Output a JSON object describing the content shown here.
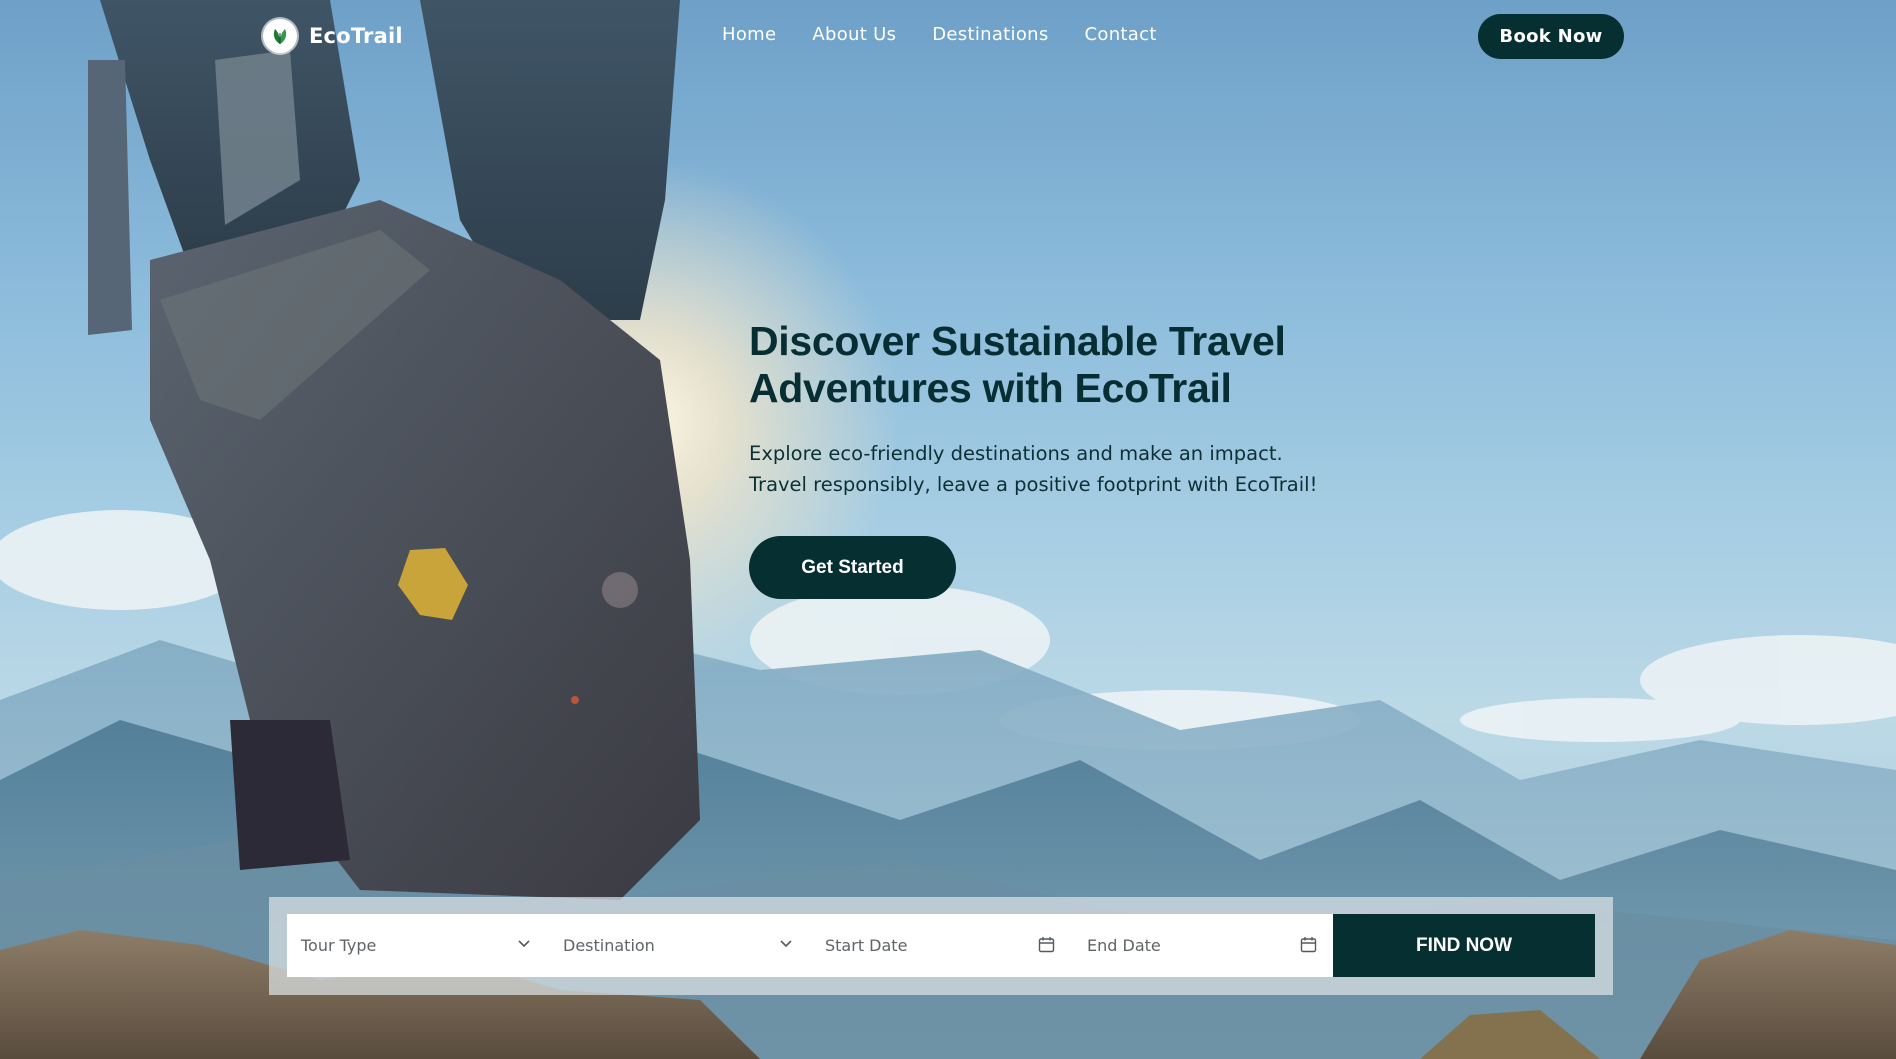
{
  "brand": {
    "name": "EcoTrail",
    "logo_icon": "leaf-icon",
    "accent_color": "#062f32"
  },
  "nav": {
    "links": [
      {
        "label": "Home"
      },
      {
        "label": "About Us"
      },
      {
        "label": "Destinations"
      },
      {
        "label": "Contact"
      }
    ],
    "book_label": "Book Now"
  },
  "hero": {
    "title_line1": "Discover Sustainable Travel",
    "title_line2": "Adventures with EcoTrail",
    "subtitle_line1": "Explore eco-friendly destinations and make an impact.",
    "subtitle_line2": "Travel responsibly, leave a positive footprint with EcoTrail!",
    "cta_label": "Get Started"
  },
  "search": {
    "tour_type_placeholder": "Tour Type",
    "destination_placeholder": "Destination",
    "start_date_placeholder": "Start Date",
    "end_date_placeholder": "End Date",
    "submit_label": "FIND NOW",
    "icons": [
      "chevron-down-icon",
      "chevron-down-icon",
      "calendar-icon",
      "calendar-icon"
    ]
  },
  "background": {
    "description_icon": "hiker-boot-mountain-photo"
  }
}
